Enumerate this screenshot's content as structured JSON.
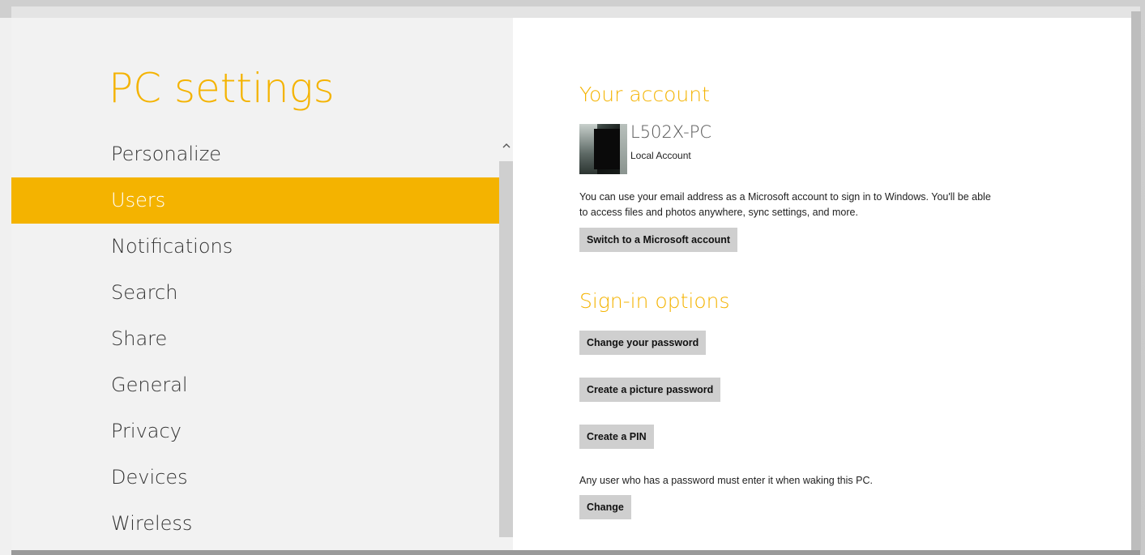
{
  "app": {
    "title": "PC settings"
  },
  "colors": {
    "accent": "#f4b300",
    "left_pane_bg": "#f2f2f2",
    "button_bg": "#cfcfcf"
  },
  "nav": {
    "items": [
      {
        "label": "Personalize",
        "selected": false
      },
      {
        "label": "Users",
        "selected": true
      },
      {
        "label": "Notifications",
        "selected": false
      },
      {
        "label": "Search",
        "selected": false
      },
      {
        "label": "Share",
        "selected": false
      },
      {
        "label": "General",
        "selected": false
      },
      {
        "label": "Privacy",
        "selected": false
      },
      {
        "label": "Devices",
        "selected": false
      },
      {
        "label": "Wireless",
        "selected": false
      }
    ],
    "scroll_up_icon": "^"
  },
  "account": {
    "section_title": "Your account",
    "name": "L502X-PC",
    "type": "Local Account",
    "description_line1": "You can use your email address as a Microsoft account to sign in to Windows. You'll be able",
    "description_line2": "to access files and photos anywhere, sync settings, and more.",
    "switch_button": "Switch to a Microsoft account"
  },
  "signin": {
    "section_title": "Sign-in options",
    "change_password_button": "Change your password",
    "picture_password_button": "Create a picture password",
    "pin_button": "Create a PIN",
    "wake_text": "Any user who has a password must enter it when waking this PC.",
    "change_button": "Change"
  }
}
